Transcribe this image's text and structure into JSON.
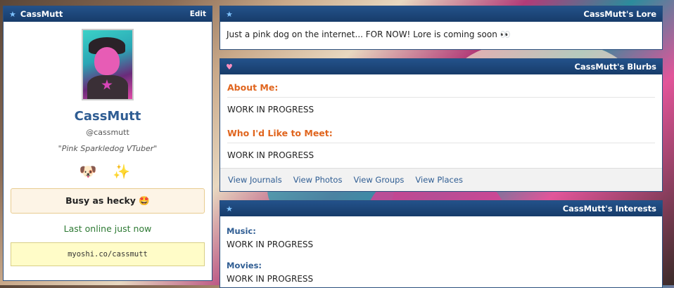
{
  "profile": {
    "header_title": "CassMutt",
    "edit_label": "Edit",
    "display_name": "CassMutt",
    "handle": "@cassmutt",
    "tagline": "\"Pink Sparkledog VTuber\"",
    "emojis": "🐶 ✨",
    "status": "Busy as hecky 🤩",
    "last_online": "Last online just now",
    "url": "myoshi.co/cassmutt"
  },
  "lore": {
    "title": "CassMutt's Lore",
    "text": "Just a pink dog on the internet... FOR NOW! Lore is coming soon 👀"
  },
  "blurbs": {
    "title": "CassMutt's Blurbs",
    "about_heading": "About Me:",
    "about_text": "WORK IN PROGRESS",
    "meet_heading": "Who I'd Like to Meet:",
    "meet_text": "WORK IN PROGRESS",
    "links": [
      "View Journals",
      "View Photos",
      "View Groups",
      "View Places"
    ]
  },
  "interests": {
    "title": "CassMutt's Interests",
    "music_label": "Music:",
    "music_value": "WORK IN PROGRESS",
    "movies_label": "Movies:",
    "movies_value": "WORK IN PROGRESS"
  },
  "colors": {
    "header_blue": "#1d4578",
    "accent_orange": "#e0651e",
    "link_blue": "#2f5d93",
    "online_green": "#2e7a34"
  }
}
